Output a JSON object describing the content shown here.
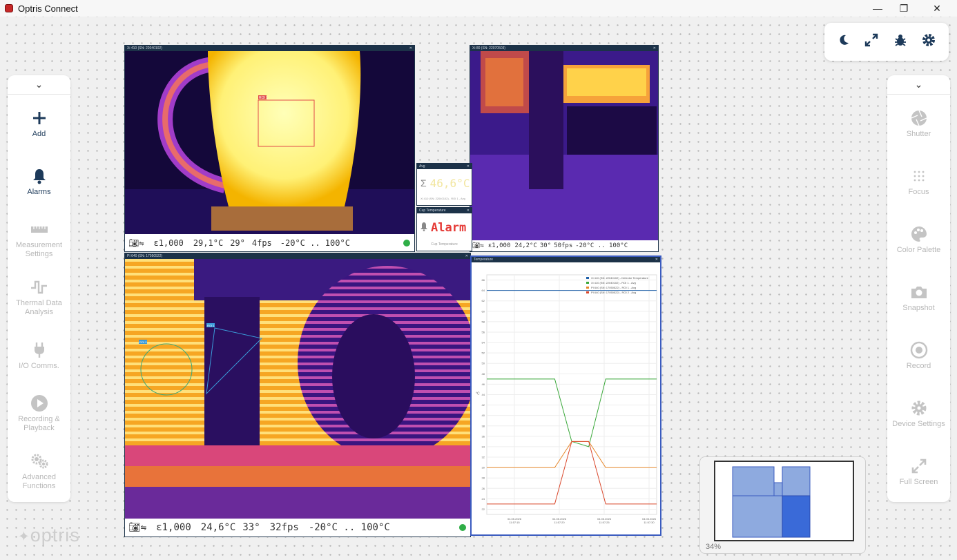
{
  "app": {
    "title": "Optris Connect"
  },
  "window_controls": {
    "minimize": "—",
    "maximize": "❐",
    "close": "✕"
  },
  "left_sidebar": {
    "items": [
      {
        "label": "Add",
        "icon": "plus-icon"
      },
      {
        "label": "Alarms",
        "icon": "bell-icon"
      },
      {
        "label": "Measurement Settings",
        "icon": "ruler-icon"
      },
      {
        "label": "Thermal Data Analysis",
        "icon": "pulse-icon"
      },
      {
        "label": "I/O Comms.",
        "icon": "plug-icon"
      },
      {
        "label": "Recording & Playback",
        "icon": "play-icon"
      },
      {
        "label": "Advanced Functions",
        "icon": "gears-icon"
      }
    ]
  },
  "right_sidebar": {
    "items": [
      {
        "label": "Shutter",
        "icon": "aperture-icon"
      },
      {
        "label": "Focus",
        "icon": "focus-icon"
      },
      {
        "label": "Color Palette",
        "icon": "palette-icon"
      },
      {
        "label": "Snapshot",
        "icon": "camera-icon"
      },
      {
        "label": "Record",
        "icon": "record-icon"
      },
      {
        "label": "Device Settings",
        "icon": "gear-icon"
      },
      {
        "label": "Full Screen",
        "icon": "expand-icon"
      }
    ]
  },
  "cam1": {
    "title": "Xi 410 (SN: 22040102)",
    "emissivity": "ε1,000",
    "temp": "29,1°C",
    "fov": "29°",
    "fps": "4fps",
    "range": "-20°C .. 100°C",
    "roi": "ROI 1"
  },
  "cam2": {
    "title": "Xi 80 (SN: 22070503)",
    "emissivity": "ε1,000",
    "temp": "24,2°C",
    "fov": "30°",
    "fps": "50fps",
    "range": "-20°C .. 100°C"
  },
  "cam3": {
    "title": "PI 640 (SN: 17050522)",
    "emissivity": "ε1,000",
    "temp": "24,6°C",
    "fov": "33°",
    "fps": "32fps",
    "range": "-20°C .. 100°C",
    "roi_a": "ROI 1",
    "roi_b": "ROI 2"
  },
  "avg_panel": {
    "title": "Avg",
    "value": "46,6°C",
    "caption": "Xi 410 (SN: 22040102) - ROI 1 - Avg"
  },
  "alarm_panel": {
    "title": "Cup Temperature",
    "value": "Alarm",
    "caption": "Cup Temperature"
  },
  "chart_panel": {
    "title": "Temperature"
  },
  "chart_data": {
    "type": "line",
    "ylabel": "°C",
    "ylim": [
      21,
      67
    ],
    "x": [
      "04.05.2026 11:57:15",
      "04.05.2026 11:57:20",
      "04.05.2026 11:57:25",
      "04.05.2026 11:57:30"
    ],
    "series": [
      {
        "name": "Xi 410 (SN: 22040102) - Detector Temperature",
        "color": "#1f5fa8",
        "values": [
          64,
          64,
          64,
          64,
          64,
          64,
          64,
          64,
          64,
          64,
          64
        ]
      },
      {
        "name": "Xi 410 (SN: 22040102) - ROI 1 - Avg",
        "color": "#3aa83a",
        "values": [
          47,
          47,
          47,
          47,
          47,
          35,
          34,
          47,
          47,
          47,
          47
        ]
      },
      {
        "name": "PI 640 (SN: 17050522) - ROI 1 - Avg",
        "color": "#e6862a",
        "values": [
          30,
          30,
          30,
          30,
          30,
          35,
          35,
          30,
          30,
          30,
          30
        ]
      },
      {
        "name": "PI 640 (SN: 17050522) - ROI 2 - Avg",
        "color": "#d9472b",
        "values": [
          23,
          23,
          23,
          23,
          23,
          35,
          35,
          23,
          23,
          23,
          23
        ]
      }
    ]
  },
  "minimap": {
    "zoom": "34%"
  },
  "logo": {
    "text": "optris"
  }
}
